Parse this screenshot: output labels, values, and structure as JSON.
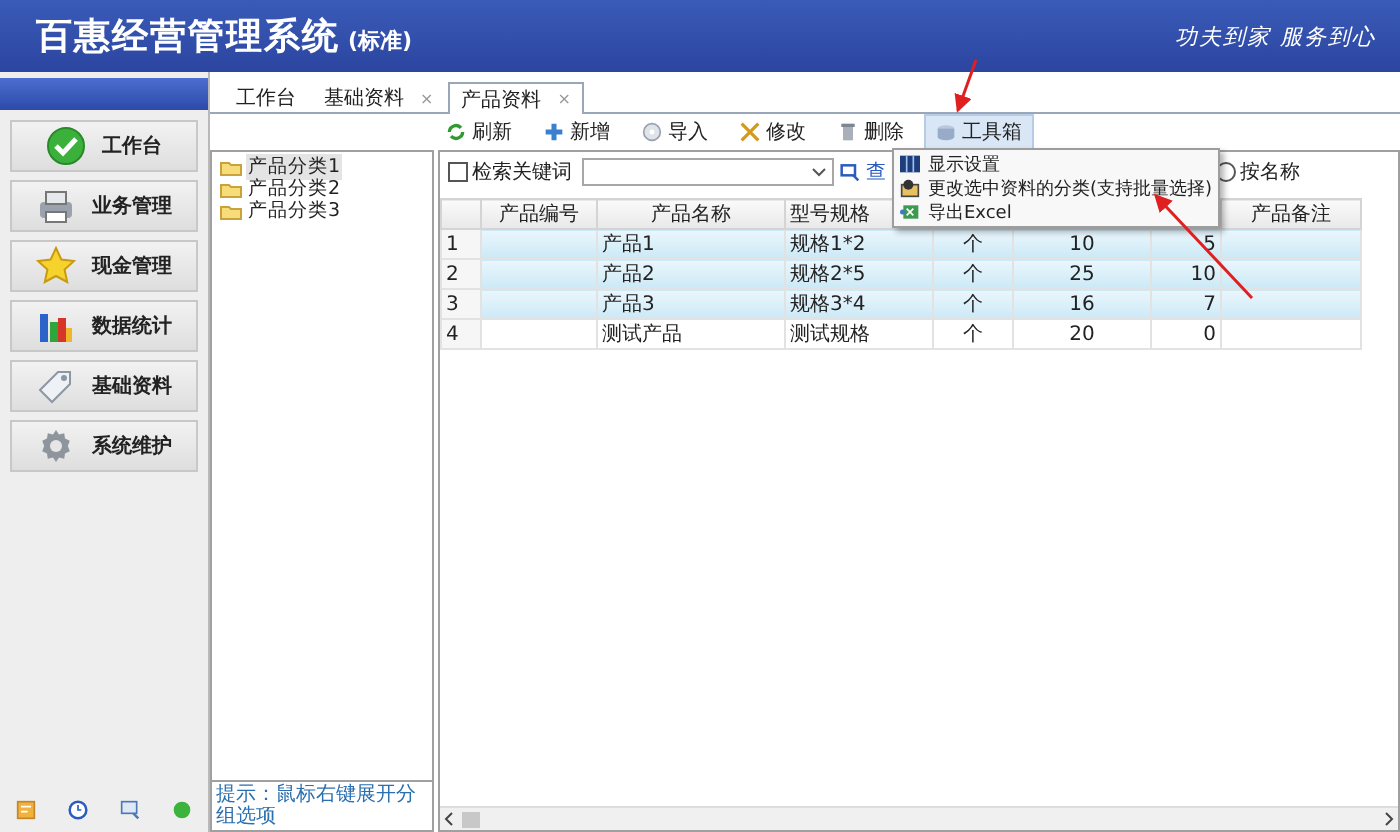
{
  "header": {
    "title": "百惠经营管理系统",
    "edition": "(标准)",
    "slogan": "功夫到家 服务到心"
  },
  "sidebar": {
    "items": [
      {
        "label": "工作台",
        "kind": "check"
      },
      {
        "label": "业务管理",
        "kind": "printer"
      },
      {
        "label": "现金管理",
        "kind": "star"
      },
      {
        "label": "数据统计",
        "kind": "chart"
      },
      {
        "label": "基础资料",
        "kind": "tag"
      },
      {
        "label": "系统维护",
        "kind": "gear"
      }
    ],
    "footer_icons": [
      {
        "kind": "note"
      },
      {
        "kind": "clock"
      },
      {
        "kind": "monitor"
      },
      {
        "kind": "dot"
      }
    ]
  },
  "tabs": [
    {
      "label": "工作台",
      "selected": false
    },
    {
      "label": "基础资料",
      "close": "×",
      "selected": false
    },
    {
      "label": "产品资料",
      "close": "×",
      "selected": true
    }
  ],
  "toolbar": [
    {
      "label": "刷新",
      "kind": "refresh",
      "selected": false
    },
    {
      "label": "新增",
      "kind": "add",
      "selected": false
    },
    {
      "label": "导入",
      "kind": "import",
      "selected": false
    },
    {
      "label": "修改",
      "kind": "edit",
      "selected": false
    },
    {
      "label": "删除",
      "kind": "delete",
      "selected": false
    },
    {
      "label": "工具箱",
      "kind": "toolbox",
      "selected": true
    }
  ],
  "menu": {
    "items": [
      {
        "label": "显示设置",
        "kind": "display"
      },
      {
        "label": "更改选中资料的分类(支持批量选择)",
        "kind": "category"
      },
      {
        "label": "导出Excel",
        "kind": "excel"
      }
    ]
  },
  "tree": {
    "items": [
      {
        "label": "产品分类1",
        "selected": true
      },
      {
        "label": "产品分类2",
        "selected": false
      },
      {
        "label": "产品分类3",
        "selected": false
      }
    ],
    "hint": "提示：鼠标右键展开分组选项"
  },
  "search": {
    "checkbox": {
      "label": "检索关键词",
      "checked": false
    },
    "find_button": "查",
    "radio": {
      "label": "按名称",
      "selected": false
    }
  },
  "table": {
    "columns": [
      {
        "label": "产品编号"
      },
      {
        "label": "产品名称"
      },
      {
        "label": "型号规格"
      },
      {},
      {},
      {},
      {
        "label": "产品备注"
      }
    ],
    "rows": [
      {
        "number": "1",
        "cells": [
          null,
          "产品1",
          "规格1*2",
          "个",
          "10",
          "5",
          null
        ],
        "selected": true
      },
      {
        "number": "2",
        "cells": [
          null,
          "产品2",
          "规格2*5",
          "个",
          "25",
          "10",
          null
        ],
        "selected": true
      },
      {
        "number": "3",
        "cells": [
          null,
          "产品3",
          "规格3*4",
          "个",
          "16",
          "7",
          null
        ],
        "selected": true
      },
      {
        "number": "4",
        "cells": [
          null,
          "测试产品",
          "测试规格",
          "个",
          "20",
          "0",
          null
        ],
        "selected": false
      }
    ]
  }
}
